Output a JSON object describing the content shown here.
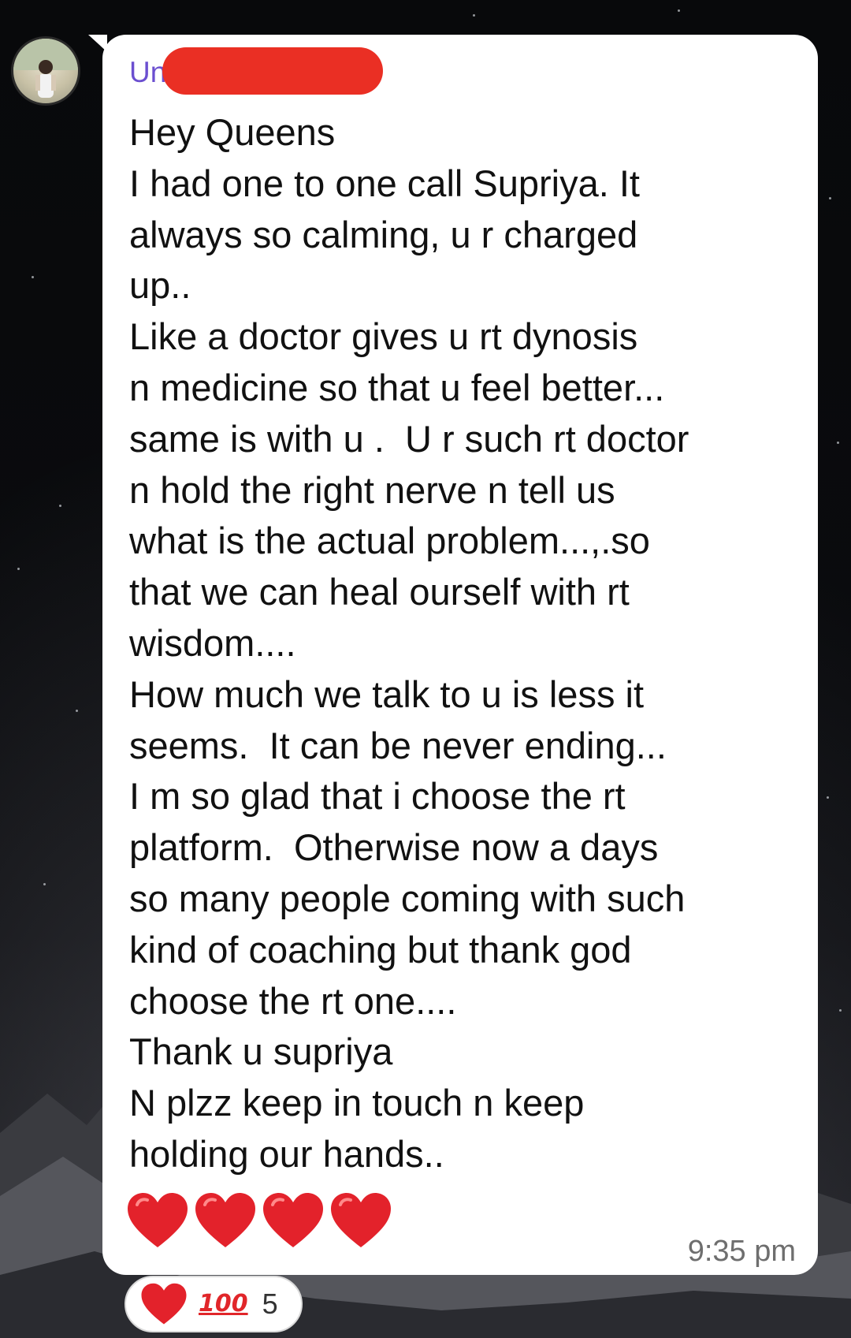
{
  "sender": {
    "name_visible": "Un"
  },
  "message": {
    "lines": [
      "Hey Queens",
      "I had one to one call Supriya. It",
      "always so calming, u r charged",
      "up..",
      "Like a doctor gives u rt dynosis",
      "n medicine so that u feel better...",
      "same is with u .  U r such rt doctor",
      "n hold the right nerve n tell us",
      "what is the actual problem...,.so",
      "that we can heal ourself with rt",
      "wisdom....",
      "How much we talk to u is less it",
      "seems.  It can be never ending...",
      "I m so glad that i choose the rt",
      "platform.  Otherwise now a days",
      "so many people coming with such",
      "kind of coaching but thank god",
      "choose the rt one....",
      "Thank u supriya",
      "N plzz keep in touch n keep",
      "holding our hands.."
    ],
    "emoji": [
      "red-heart",
      "red-heart",
      "red-heart",
      "red-heart"
    ],
    "time": "9:35 pm"
  },
  "reactions": {
    "emoji": [
      "red-heart",
      "hundred-points"
    ],
    "hundred_label": "100",
    "count": "5"
  },
  "colors": {
    "sender_name": "#6b4fd0",
    "redaction": "#ea2f24",
    "heart": "#e3222b",
    "bubble": "#ffffff",
    "timestamp": "#6e6e6e"
  }
}
